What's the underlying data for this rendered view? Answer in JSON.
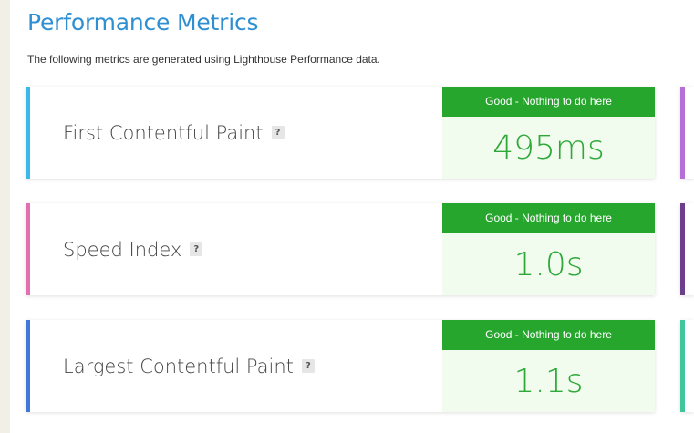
{
  "header": {
    "title": "Performance Metrics",
    "subtitle": "The following metrics are generated using Lighthouse Performance data."
  },
  "metrics": [
    {
      "label": "First Contentful Paint",
      "help": "?",
      "status": "Good - Nothing to do here",
      "value": "495ms",
      "accent": "#3ab8e8"
    },
    {
      "label": "Speed Index",
      "help": "?",
      "status": "Good - Nothing to do here",
      "value": "1.0s",
      "accent": "#e46fb0"
    },
    {
      "label": "Largest Contentful Paint",
      "help": "?",
      "status": "Good - Nothing to do here",
      "value": "1.1s",
      "accent": "#3f78d6"
    }
  ],
  "side_accents": [
    "#b56fd6",
    "#6b3f8c",
    "#3fc69a"
  ],
  "colors": {
    "title": "#2f8fd3",
    "good_badge": "#27a62e",
    "good_value": "#2ea838",
    "good_background": "#f1fcef"
  }
}
